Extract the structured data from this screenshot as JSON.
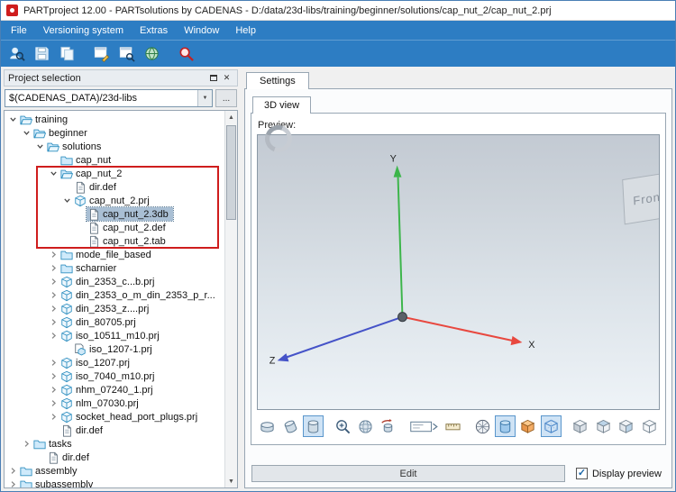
{
  "window": {
    "title": "PARTproject 12.00 - PARTsolutions by CADENAS - D:/data/23d-libs/training/beginner/solutions/cap_nut_2/cap_nut_2.prj"
  },
  "colors": {
    "menu_blue": "#2d7dc3",
    "selection": "#a9bfd4",
    "highlight_red": "#cf1d1d",
    "axis_x": "#e8483f",
    "axis_y": "#3cb54a",
    "axis_z": "#4553c8"
  },
  "menu": {
    "items": [
      "File",
      "Versioning system",
      "Extras",
      "Window",
      "Help"
    ]
  },
  "toolbar": {
    "icons": [
      {
        "name": "project-search"
      },
      {
        "name": "save"
      },
      {
        "name": "copy-project"
      },
      {
        "name": "edit-project",
        "gap": true
      },
      {
        "name": "project-preview"
      },
      {
        "name": "publish-web"
      },
      {
        "name": "quality-search",
        "gap": true
      }
    ]
  },
  "left_panel": {
    "title": "Project selection",
    "path_value": "$(CADENAS_DATA)/23d-libs",
    "browse_label": "...",
    "tree": [
      {
        "label": "training",
        "level": 0,
        "icon": "folder-open",
        "expand": "open"
      },
      {
        "label": "beginner",
        "level": 1,
        "icon": "folder-open",
        "expand": "open"
      },
      {
        "label": "solutions",
        "level": 2,
        "icon": "folder-open",
        "expand": "open"
      },
      {
        "label": "cap_nut",
        "level": 3,
        "icon": "folder",
        "expand": "none"
      },
      {
        "label": "cap_nut_2",
        "level": 3,
        "icon": "folder-open",
        "expand": "open",
        "red": true
      },
      {
        "label": "dir.def",
        "level": 4,
        "icon": "doc",
        "expand": "none",
        "red": true
      },
      {
        "label": "cap_nut_2.prj",
        "level": 4,
        "icon": "part",
        "expand": "open",
        "red": true
      },
      {
        "label": "cap_nut_2.3db",
        "level": 5,
        "icon": "doc",
        "expand": "none",
        "red": true,
        "selected": true
      },
      {
        "label": "cap_nut_2.def",
        "level": 5,
        "icon": "doc",
        "expand": "none",
        "red": true
      },
      {
        "label": "cap_nut_2.tab",
        "level": 5,
        "icon": "doc",
        "expand": "none",
        "red": true
      },
      {
        "label": "mode_file_based",
        "level": 3,
        "icon": "folder",
        "expand": "closed"
      },
      {
        "label": "scharnier",
        "level": 3,
        "icon": "folder",
        "expand": "closed"
      },
      {
        "label": "din_2353_c...b.prj",
        "level": 3,
        "icon": "part",
        "expand": "closed"
      },
      {
        "label": "din_2353_o_m_din_2353_p_r...",
        "level": 3,
        "icon": "part",
        "expand": "closed"
      },
      {
        "label": "din_2353_z....prj",
        "level": 3,
        "icon": "part",
        "expand": "closed"
      },
      {
        "label": "din_80705.prj",
        "level": 3,
        "icon": "part",
        "expand": "closed"
      },
      {
        "label": "iso_10511_m10.prj",
        "level": 3,
        "icon": "part",
        "expand": "closed"
      },
      {
        "label": "iso_1207-1.prj",
        "level": 4,
        "icon": "part-doc",
        "expand": "none"
      },
      {
        "label": "iso_1207.prj",
        "level": 3,
        "icon": "part",
        "expand": "closed"
      },
      {
        "label": "iso_7040_m10.prj",
        "level": 3,
        "icon": "part",
        "expand": "closed"
      },
      {
        "label": "nhm_07240_1.prj",
        "level": 3,
        "icon": "part",
        "expand": "closed"
      },
      {
        "label": "nlm_07030.prj",
        "level": 3,
        "icon": "part",
        "expand": "closed"
      },
      {
        "label": "socket_head_port_plugs.prj",
        "level": 3,
        "icon": "part",
        "expand": "closed"
      },
      {
        "label": "dir.def",
        "level": 3,
        "icon": "doc",
        "expand": "none"
      },
      {
        "label": "tasks",
        "level": 1,
        "icon": "folder",
        "expand": "closed"
      },
      {
        "label": "dir.def",
        "level": 2,
        "icon": "doc",
        "expand": "none"
      },
      {
        "label": "assembly",
        "level": 0,
        "icon": "folder",
        "expand": "closed"
      },
      {
        "label": "subassembly",
        "level": 0,
        "icon": "folder",
        "expand": "closed"
      }
    ]
  },
  "right_panel": {
    "tab_label": "Settings",
    "subtab_label": "3D view",
    "preview_label": "Preview:",
    "navcube_label": "Front",
    "axes": {
      "x": "X",
      "y": "Y",
      "z": "Z"
    },
    "view_toolbar": [
      {
        "name": "view-cylinder-top"
      },
      {
        "name": "view-cylinder-iso"
      },
      {
        "name": "view-cylinder-front",
        "pressed": true
      },
      {
        "name": "zoom-fit",
        "gap": true
      },
      {
        "name": "view-sphere"
      },
      {
        "name": "turntable-rotation"
      },
      {
        "name": "dimension-label",
        "wide": true,
        "gap": true
      },
      {
        "name": "measure-ruler"
      },
      {
        "name": "render-mesh",
        "gap": true
      },
      {
        "name": "render-shaded-cylinder",
        "pressed": true
      },
      {
        "name": "render-solid-box"
      },
      {
        "name": "render-wireframe-box",
        "pressed": true
      },
      {
        "name": "view-cube-front",
        "gap": true
      },
      {
        "name": "view-cube-top"
      },
      {
        "name": "view-cube-side"
      },
      {
        "name": "view-cube-iso"
      }
    ],
    "edit_label": "Edit",
    "display_preview_label": "Display preview",
    "display_preview_checked": true
  }
}
